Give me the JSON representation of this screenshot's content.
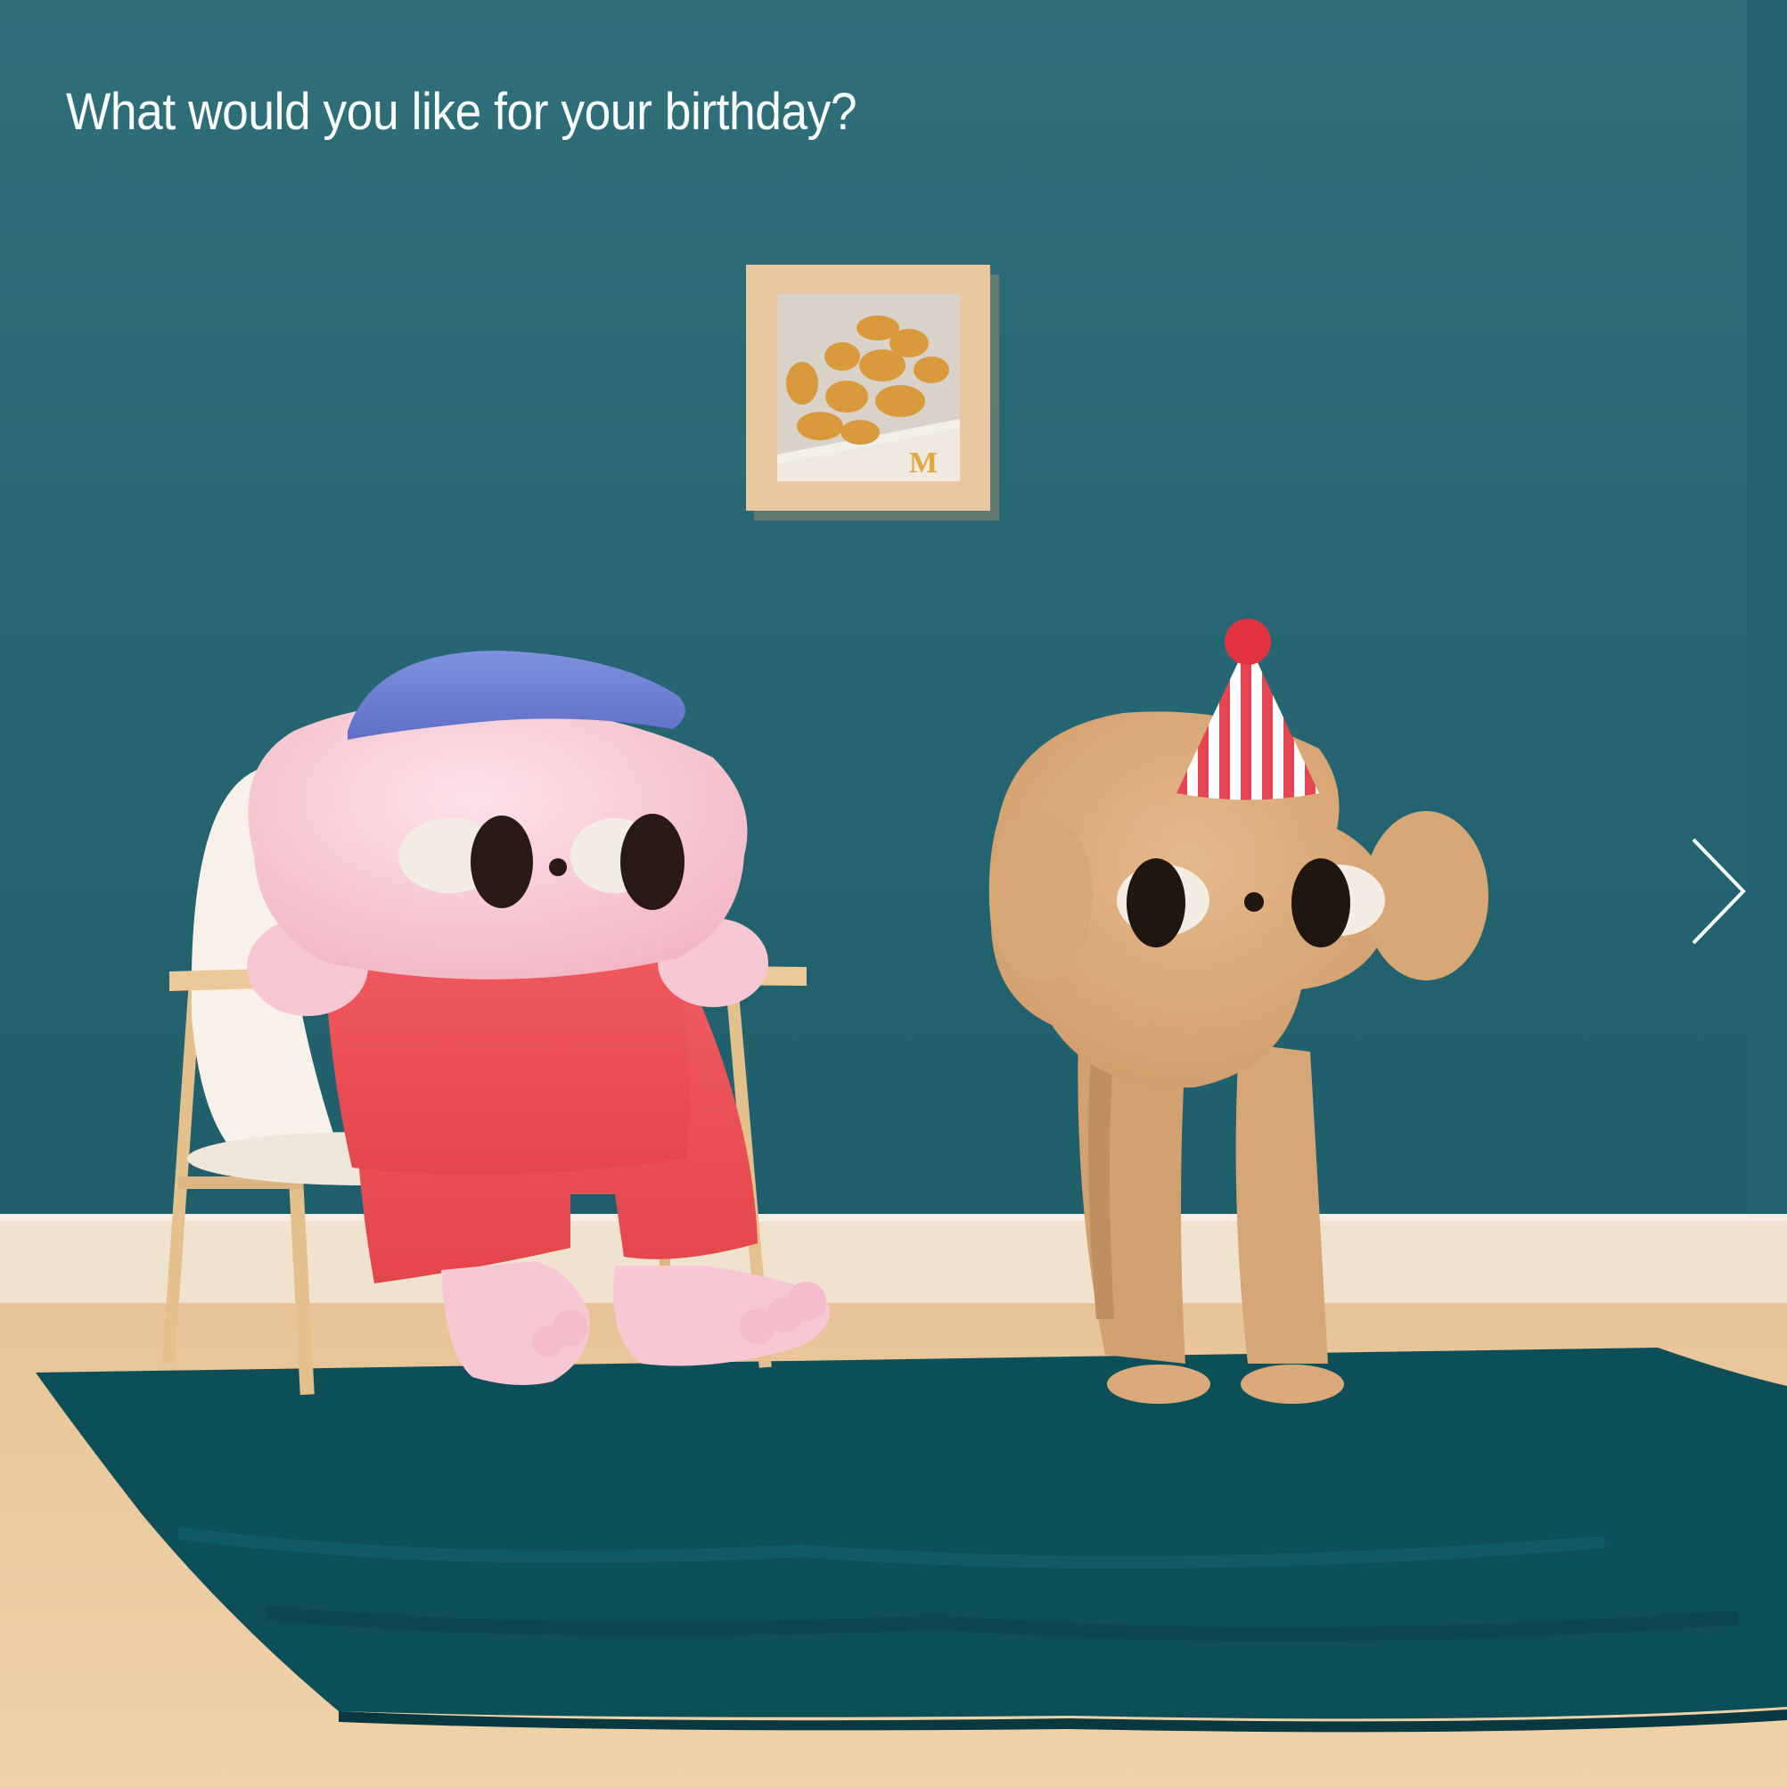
{
  "story": {
    "caption": "What would you like for your birthday?"
  },
  "navigation": {
    "next_icon": "chevron-right-icon"
  },
  "framed_picture": {
    "logo_text": "M"
  },
  "colors": {
    "wall": "#2a6a76",
    "floor": "#e9c79a",
    "rug": "#0c4f58",
    "caption": "#ffffff",
    "chevron": "#ffffff"
  }
}
